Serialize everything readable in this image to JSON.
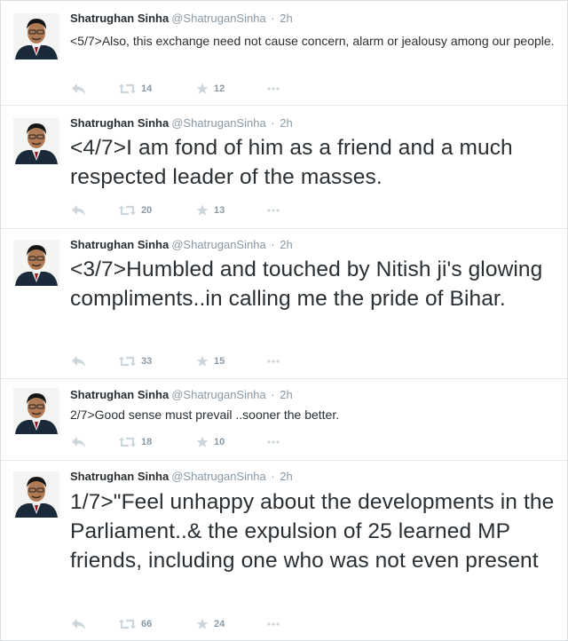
{
  "tweets": [
    {
      "name": "Shatrughan Sinha",
      "handle": "@ShatruganSinha",
      "separator": "·",
      "time": "2h",
      "text": "<5/7>Also, this exchange need not cause concern, alarm or jealousy among our people.",
      "retweets": "14",
      "favorites": "12"
    },
    {
      "name": "Shatrughan Sinha",
      "handle": "@ShatruganSinha",
      "separator": "·",
      "time": "2h",
      "text": "<4/7>I am fond of him as a friend and a much respected leader of the masses.",
      "retweets": "20",
      "favorites": "13"
    },
    {
      "name": "Shatrughan Sinha",
      "handle": "@ShatruganSinha",
      "separator": "·",
      "time": "2h",
      "text": "<3/7>Humbled and touched by Nitish ji's glowing compliments..in calling me the pride of Bihar.",
      "retweets": "33",
      "favorites": "15"
    },
    {
      "name": "Shatrughan Sinha",
      "handle": "@ShatruganSinha",
      "separator": "·",
      "time": "2h",
      "text": "2/7>Good sense must prevail ..sooner the better.",
      "retweets": "18",
      "favorites": "10"
    },
    {
      "name": "Shatrughan Sinha",
      "handle": "@ShatruganSinha",
      "separator": "·",
      "time": "2h",
      "text": "1/7>\"Feel unhappy about the developments in the Parliament..& the expulsion of 25 learned MP friends, including one who was not even present",
      "retweets": "66",
      "favorites": "24"
    }
  ],
  "icons": {
    "reply": "reply-icon",
    "retweet": "retweet-icon",
    "favorite": "star-icon",
    "more": "more-icon"
  },
  "colors": {
    "name": "#292f33",
    "meta": "#8899a6",
    "icon": "#ccd6dd",
    "border": "#e1e8ed"
  }
}
